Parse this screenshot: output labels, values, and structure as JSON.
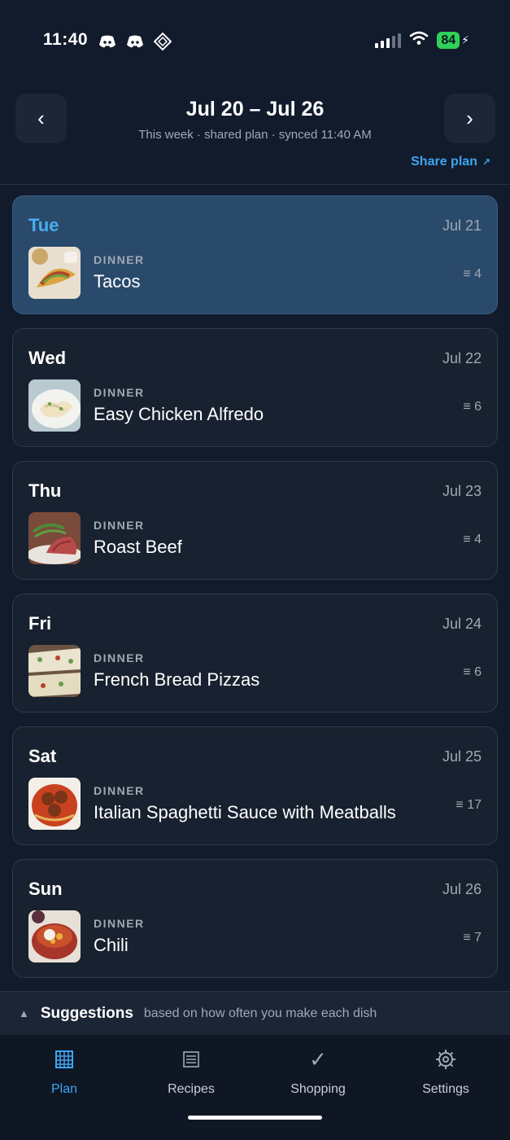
{
  "status_bar": {
    "time": "11:40",
    "battery": "84",
    "icons": [
      "discord-icon",
      "discord-icon",
      "app-diamond-icon",
      "signal-icon",
      "wifi-icon",
      "battery-icon"
    ]
  },
  "header": {
    "prev_icon": "‹",
    "next_icon": "›",
    "title": "Jul 20 – Jul 26",
    "subtitle": "This week · shared plan · synced 11:40 AM",
    "share_label": "Share plan",
    "share_arrow": "↗"
  },
  "days": [
    {
      "day": "Tue",
      "date": "Jul 21",
      "meal": "DINNER",
      "title": "Tacos",
      "count": "≡ 4",
      "selected": true
    },
    {
      "day": "Wed",
      "date": "Jul 22",
      "meal": "DINNER",
      "title": "Easy Chicken Alfredo",
      "count": "≡ 6",
      "selected": false
    },
    {
      "day": "Thu",
      "date": "Jul 23",
      "meal": "DINNER",
      "title": "Roast Beef",
      "count": "≡ 4",
      "selected": false
    },
    {
      "day": "Fri",
      "date": "Jul 24",
      "meal": "DINNER",
      "title": "French Bread Pizzas",
      "count": "≡ 6",
      "selected": false
    },
    {
      "day": "Sat",
      "date": "Jul 25",
      "meal": "DINNER",
      "title": "Italian Spaghetti Sauce with Meatballs",
      "count": "≡ 17",
      "selected": false
    },
    {
      "day": "Sun",
      "date": "Jul 26",
      "meal": "DINNER",
      "title": "Chili",
      "count": "≡ 7",
      "selected": false
    }
  ],
  "suggestions": {
    "caret": "▲",
    "title": "Suggestions",
    "description": "based on how often you make each dish"
  },
  "tabs": [
    {
      "label": "Plan",
      "icon": "calendar-grid-icon",
      "active": true
    },
    {
      "label": "Recipes",
      "icon": "list-icon",
      "active": false
    },
    {
      "label": "Shopping",
      "icon": "checkmark-icon",
      "active": false
    },
    {
      "label": "Settings",
      "icon": "gear-icon",
      "active": false
    }
  ],
  "colors": {
    "background": "#121b2b",
    "card": "#18212f",
    "selected_card": "#2a4a6b",
    "accent": "#3ea6f0",
    "battery": "#30d158"
  }
}
